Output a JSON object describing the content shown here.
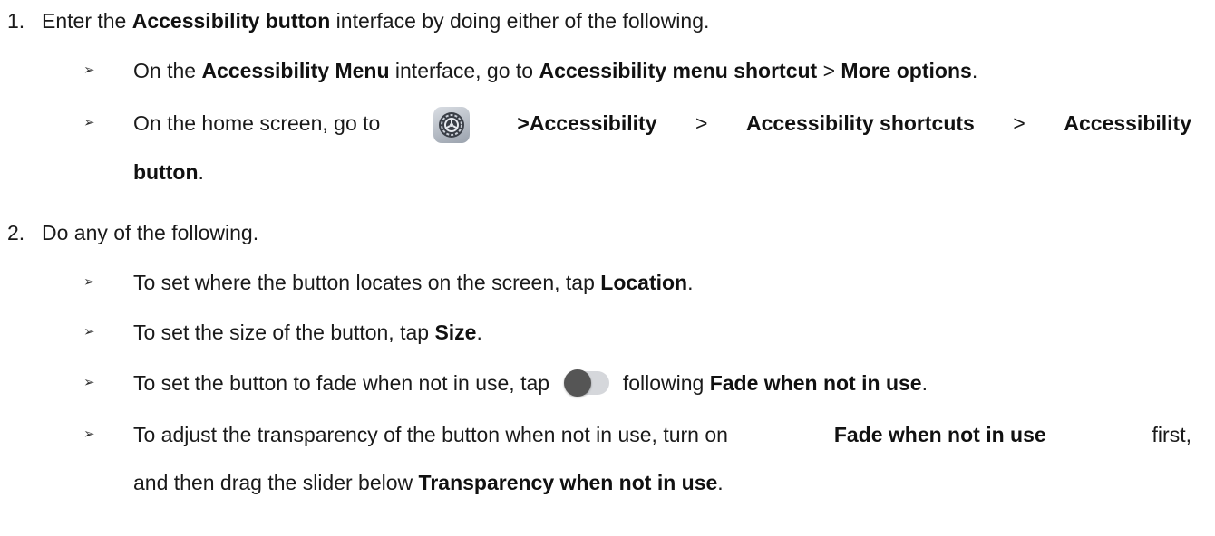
{
  "step1": {
    "number": "1.",
    "prefix": "Enter the",
    "bold": "Accessibility button",
    "suffix": "interface by doing either of the following."
  },
  "step1_bullets": [
    {
      "marker": "➢",
      "t1": "On the",
      "b1": "Accessibility Menu",
      "t2": "interface, go to",
      "b2": "Accessibility menu shortcut",
      "t3": ">",
      "b3": "More options",
      "t4": "."
    },
    {
      "marker": "➢",
      "t1": "On the home screen, go to",
      "icon": "settings-gear-icon",
      "b1": ">Accessibility",
      "t2": ">",
      "b2": "Accessibility shortcuts",
      "t3": ">",
      "b3": "Accessibility",
      "b4": "button",
      "t4": "."
    }
  ],
  "step2": {
    "number": "2.",
    "text": "Do any of the following."
  },
  "step2_bullets": [
    {
      "marker": "➢",
      "t1": "To set where the button locates on the screen, tap",
      "b1": "Location",
      "t2": "."
    },
    {
      "marker": "➢",
      "t1": "To set the size of the button, tap",
      "b1": "Size",
      "t2": "."
    },
    {
      "marker": "➢",
      "t1": "To set the button to fade when not in use, tap",
      "icon": "toggle-switch-off-icon",
      "t2": "following",
      "b1": "Fade when not in use",
      "t3": "."
    },
    {
      "marker": "➢",
      "t1": "To adjust the transparency of the button when not in use, turn on",
      "b1": "Fade when not in use",
      "t2": "first,",
      "t3": "and then drag the slider below",
      "b2": "Transparency when not in use",
      "t4": "."
    }
  ]
}
